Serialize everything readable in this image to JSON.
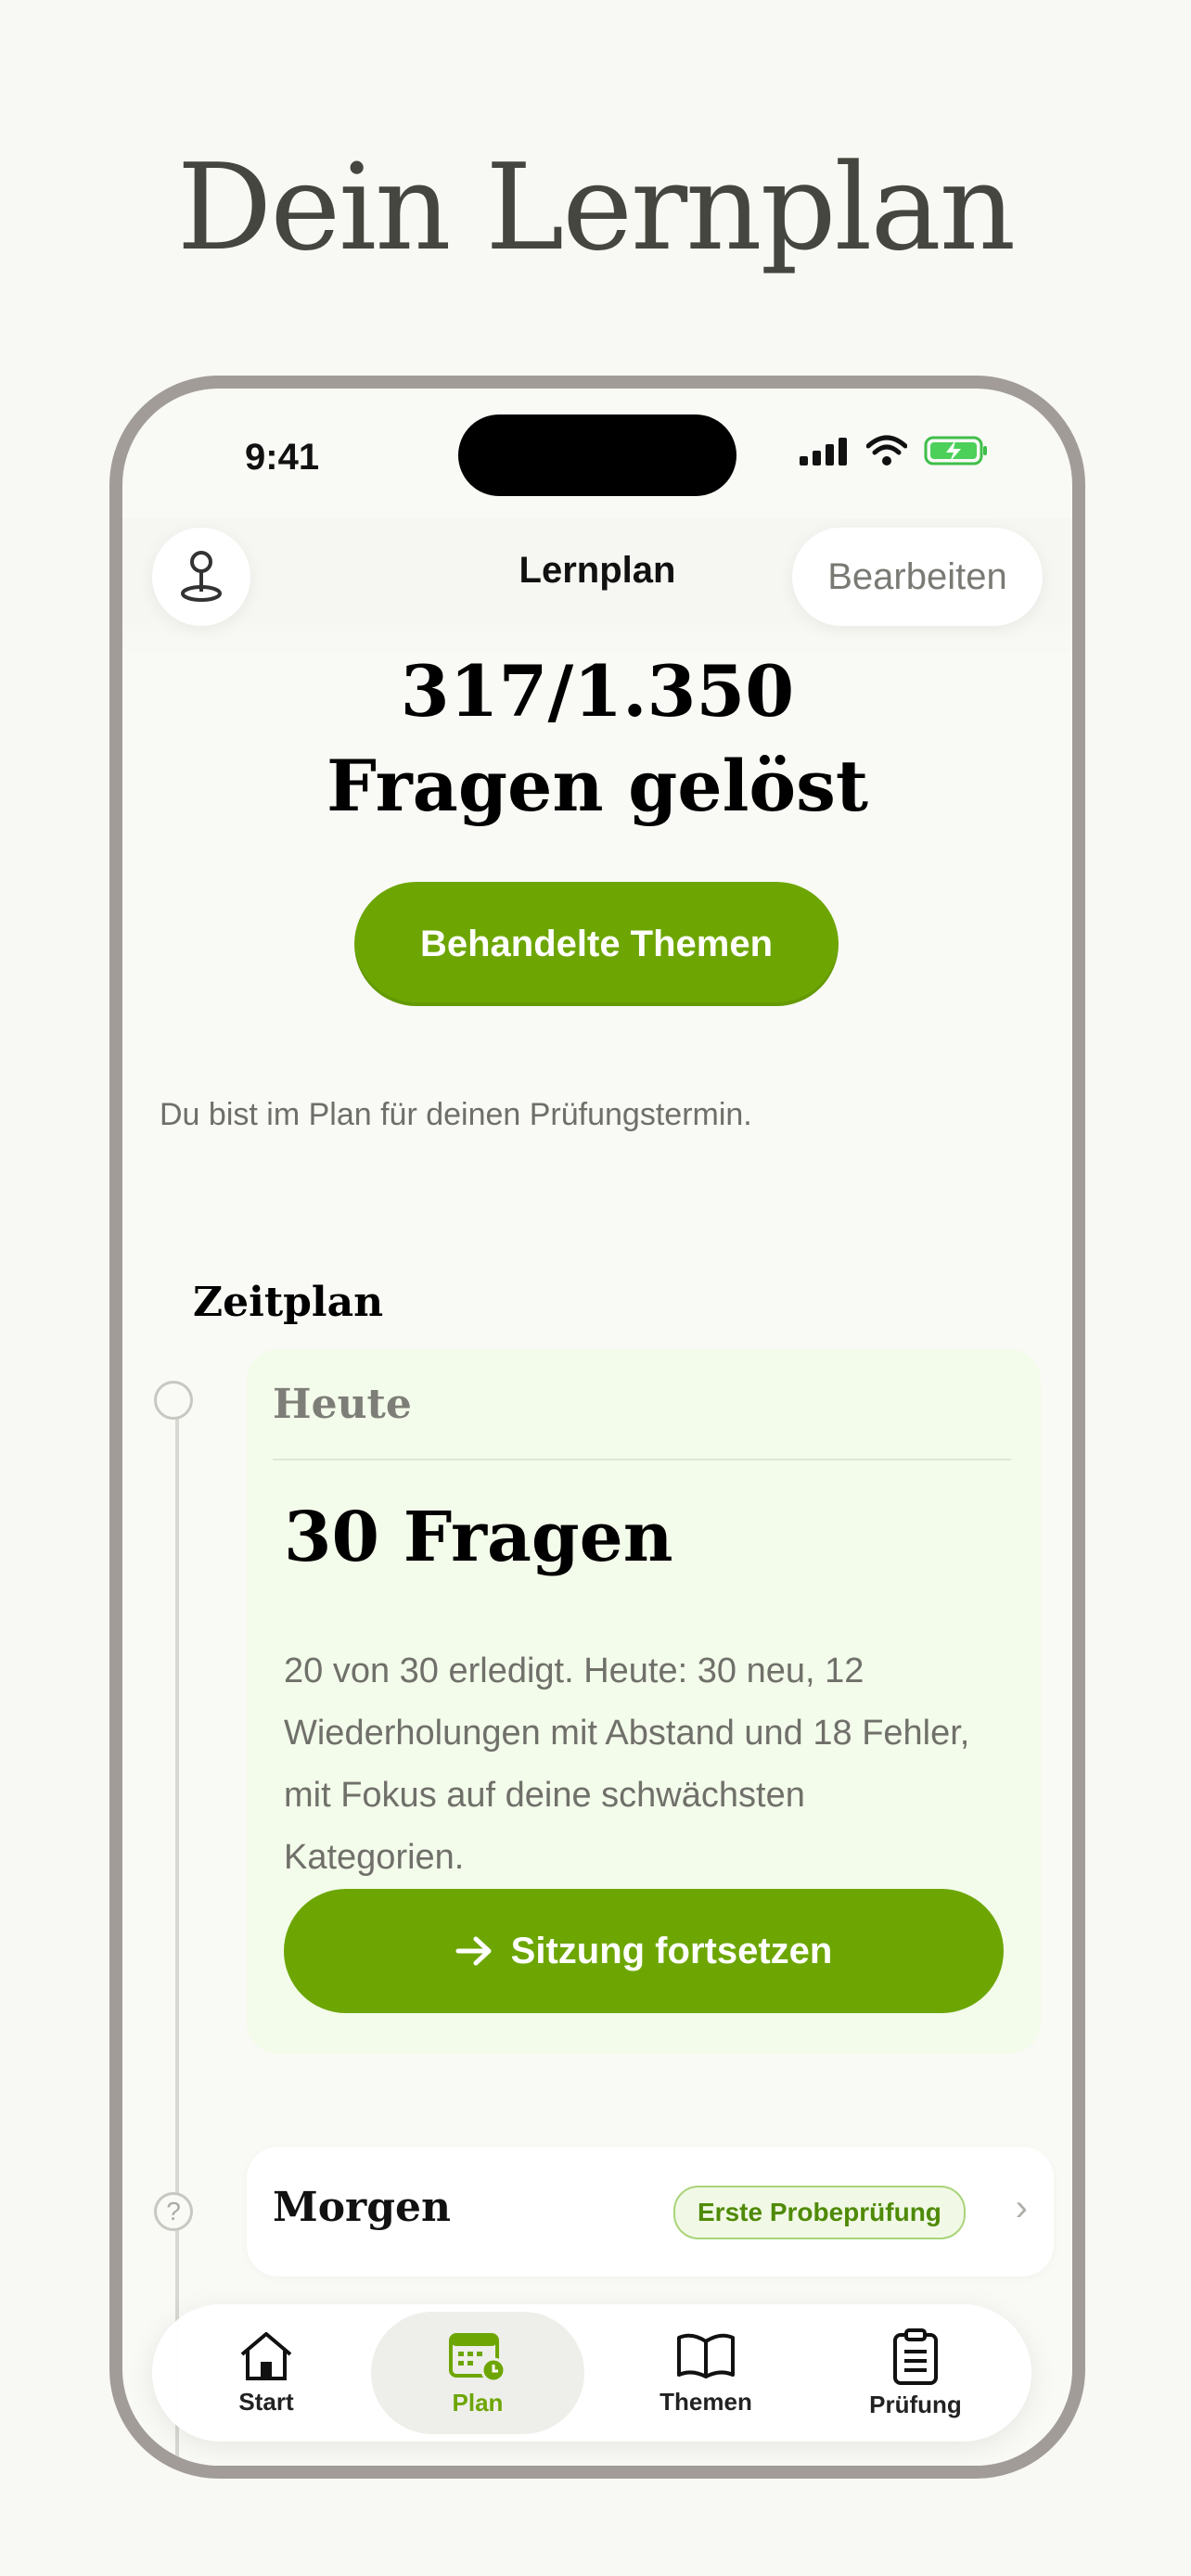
{
  "headline": "Dein Lernplan",
  "status_bar": {
    "time": "9:41"
  },
  "header": {
    "title": "Lernplan",
    "edit_label": "Bearbeiten"
  },
  "progress": {
    "count": "317/1.350",
    "label": "Fragen gelöst"
  },
  "topics_button": "Behandelte Themen",
  "plan_note": "Du bist im Plan für deinen Prüfungstermin.",
  "schedule": {
    "title": "Zeitplan",
    "today": {
      "label": "Heute",
      "count": "30 Fragen",
      "description": "20 von 30 erledigt. Heute: 30 neu, 12 Wiederholungen mit Abstand und 18 Fehler, mit Fokus auf deine schwächsten Kategorien.",
      "continue_label": "Sitzung fortsetzen"
    },
    "tomorrow": {
      "label": "Morgen",
      "badge": "Erste Probeprüfung"
    }
  },
  "tabs": [
    {
      "label": "Start",
      "icon": "home-icon"
    },
    {
      "label": "Plan",
      "icon": "calendar-icon",
      "active": true
    },
    {
      "label": "Themen",
      "icon": "book-icon"
    },
    {
      "label": "Prüfung",
      "icon": "clipboard-icon"
    }
  ],
  "colors": {
    "accent": "#6da603",
    "background": "#f8f8f4",
    "frame": "#a29c99"
  }
}
